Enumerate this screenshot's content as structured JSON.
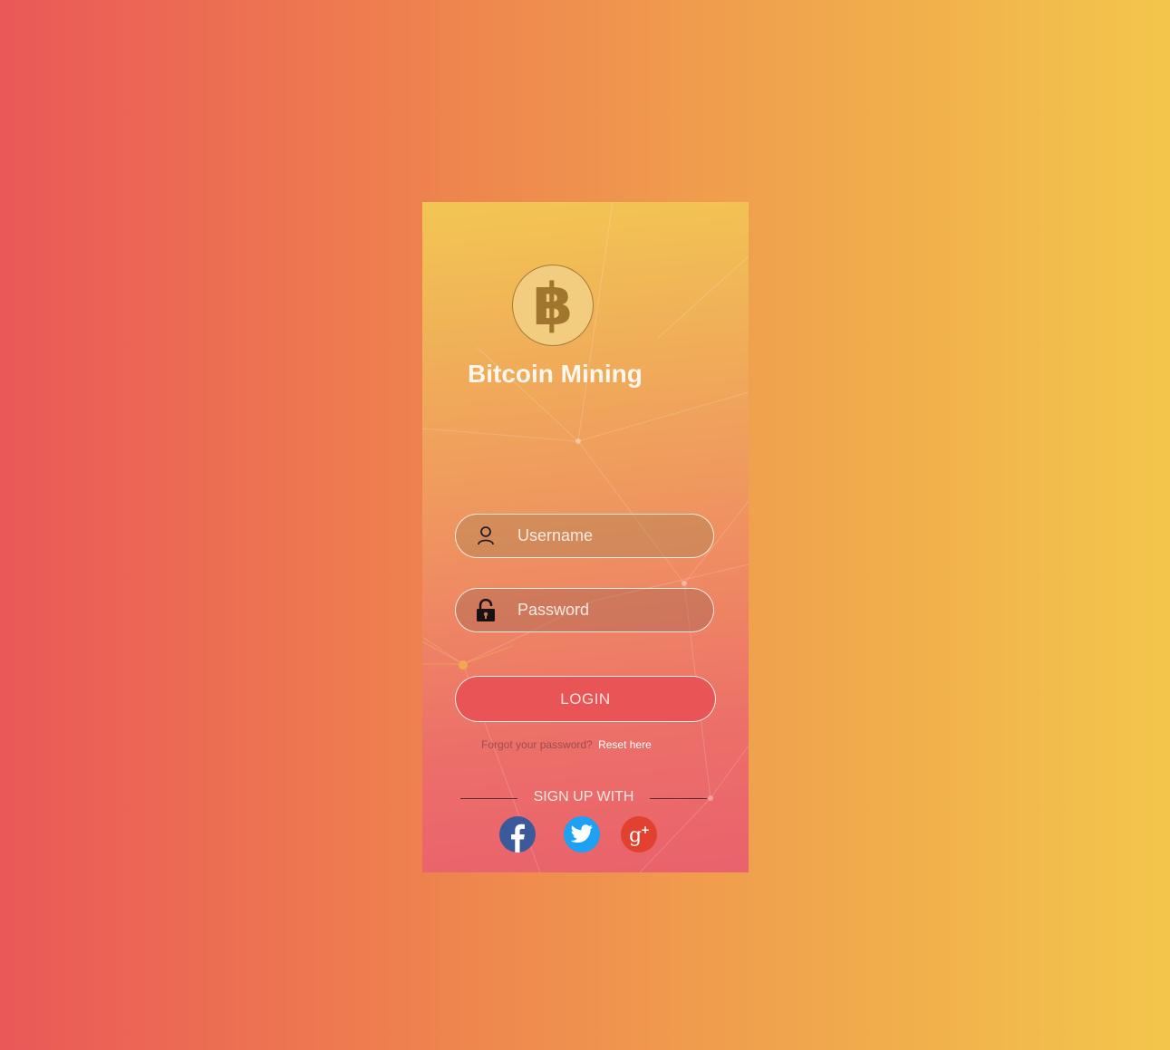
{
  "app": {
    "title": "Bitcoin Mining",
    "logo_icon": "bitcoin-icon",
    "logo_glyph": "฿"
  },
  "login_form": {
    "username": {
      "placeholder": "Username",
      "value": "",
      "icon": "user-icon"
    },
    "password": {
      "placeholder": "Password",
      "value": "",
      "icon": "lock-icon"
    },
    "login_label": "LOGIN",
    "forgot_text": "Forgot your password?",
    "reset_link": "Reset here"
  },
  "signup": {
    "label": "SIGN UP WITH",
    "providers": [
      {
        "name": "facebook",
        "icon": "facebook-icon",
        "color": "#3b5a9a"
      },
      {
        "name": "twitter",
        "icon": "twitter-icon",
        "color": "#1da1f2"
      },
      {
        "name": "google-plus",
        "icon": "google-plus-icon",
        "color": "#e2412f"
      }
    ]
  },
  "colors": {
    "background_left": "#ea5858",
    "background_right": "#f3c64b",
    "button": "#e95456"
  }
}
